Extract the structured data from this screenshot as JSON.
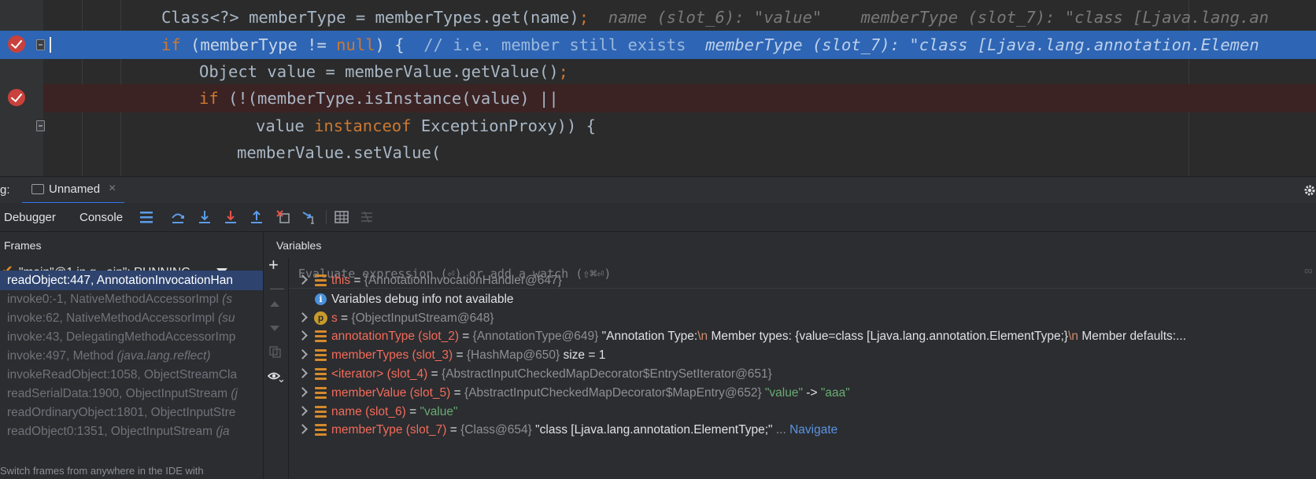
{
  "editor": {
    "lines": [
      {
        "code": [
          [
            "tx",
            "Class<?> memberType = memberTypes.get(name)"
          ],
          [
            "kw",
            ";"
          ]
        ],
        "inline": "  name (slot_6): \"value\"    memberType (slot_7): \"class [Ljava.lang.an"
      },
      {
        "code": [
          [
            "kw",
            "if "
          ],
          [
            "tx",
            "(memberType != "
          ],
          [
            "kw",
            "null"
          ],
          [
            "tx",
            ") {  "
          ],
          [
            "cm",
            "// i.e. member still exists"
          ]
        ],
        "inline": "  memberType (slot_7): \"class [Ljava.lang.annotation.Elemen"
      },
      {
        "code": [
          [
            "tx",
            "Object value = memberValue.getValue()"
          ],
          [
            "kw",
            ";"
          ]
        ],
        "inline": ""
      },
      {
        "code": [
          [
            "kw",
            "if "
          ],
          [
            "tx",
            "(!(memberType.isInstance(value) ||"
          ]
        ],
        "inline": ""
      },
      {
        "code": [
          [
            "tx",
            "value "
          ],
          [
            "kw",
            "instanceof "
          ],
          [
            "tx",
            "ExceptionProxy)) {"
          ]
        ],
        "inline": ""
      },
      {
        "code": [
          [
            "tx",
            "memberValue.setValue("
          ]
        ],
        "inline": ""
      }
    ]
  },
  "debug_bar": {
    "label": "g:",
    "session_tab": "Unnamed",
    "close_glyph": "×"
  },
  "tabs": {
    "debugger": "Debugger",
    "console": "Console"
  },
  "frames": {
    "header": "Frames",
    "thread": "\"main\"@1 in g...ain\": RUNNING",
    "items": [
      {
        "method": "readObject:447, AnnotationInvocationHan",
        "pkg": ""
      },
      {
        "method": "invoke0:-1, NativeMethodAccessorImpl ",
        "pkg": "(s"
      },
      {
        "method": "invoke:62, NativeMethodAccessorImpl ",
        "pkg": "(su"
      },
      {
        "method": "invoke:43, DelegatingMethodAccessorImp",
        "pkg": ""
      },
      {
        "method": "invoke:497, Method ",
        "pkg": "(java.lang.reflect)"
      },
      {
        "method": "invokeReadObject:1058, ObjectStreamCla",
        "pkg": ""
      },
      {
        "method": "readSerialData:1900, ObjectInputStream ",
        "pkg": "(j"
      },
      {
        "method": "readOrdinaryObject:1801, ObjectInputStre",
        "pkg": ""
      },
      {
        "method": "readObject0:1351, ObjectInputStream ",
        "pkg": "(ja"
      }
    ],
    "hint": "Switch frames from anywhere in the IDE with"
  },
  "variables": {
    "header": "Variables",
    "eval_placeholder": "Evaluate expression (⏎) or add a watch (⇧⌘⏎)",
    "rows": [
      {
        "icon": "field",
        "expand": true,
        "name": "this",
        "eq": " = ",
        "type": "{AnnotationInvocationHandler@647}",
        "rest": [],
        "nav": ""
      },
      {
        "icon": "info",
        "expand": false,
        "name": "",
        "eq": "",
        "type": "",
        "rest": [
          [
            "vw",
            "Variables debug info not available"
          ]
        ],
        "nav": ""
      },
      {
        "icon": "param",
        "expand": true,
        "name": "s",
        "eq": " = ",
        "type": "{ObjectInputStream@648}",
        "rest": [],
        "nav": ""
      },
      {
        "icon": "field",
        "expand": true,
        "name": "annotationType (slot_2)",
        "eq": " = ",
        "type": "{AnnotationType@649}",
        "rest": [
          [
            "vw",
            " \"Annotation Type:"
          ],
          [
            "vo",
            "\\n"
          ],
          [
            "vw",
            "   Member types: {value=class [Ljava.lang.annotation.ElementType;}"
          ],
          [
            "vo",
            "\\n"
          ],
          [
            "vw",
            "   Member defaults:..."
          ]
        ],
        "nav": ""
      },
      {
        "icon": "field",
        "expand": true,
        "name": "memberTypes (slot_3)",
        "eq": " = ",
        "type": "{HashMap@650}",
        "rest": [
          [
            "vw",
            "  size = 1"
          ]
        ],
        "nav": ""
      },
      {
        "icon": "field",
        "expand": true,
        "name": "<iterator> (slot_4)",
        "eq": " = ",
        "type": "{AbstractInputCheckedMapDecorator$EntrySetIterator@651}",
        "rest": [],
        "nav": ""
      },
      {
        "icon": "field",
        "expand": true,
        "name": "memberValue (slot_5)",
        "eq": " = ",
        "type": "{AbstractInputCheckedMapDecorator$MapEntry@652}",
        "rest": [
          [
            "vs",
            " \"value\""
          ],
          [
            "vw",
            " -> "
          ],
          [
            "vs",
            "\"aaa\""
          ]
        ],
        "nav": ""
      },
      {
        "icon": "field",
        "expand": true,
        "name": "name (slot_6)",
        "eq": " = ",
        "type": "",
        "rest": [
          [
            "vs",
            "\"value\""
          ]
        ],
        "nav": ""
      },
      {
        "icon": "field",
        "expand": true,
        "name": "memberType (slot_7)",
        "eq": " = ",
        "type": "{Class@654}",
        "rest": [
          [
            "vw",
            " \"class [Ljava.lang.annotation.ElementType;\""
          ],
          [
            "vt",
            " ... "
          ]
        ],
        "nav": "Navigate"
      }
    ]
  },
  "colors": {
    "execution_line": "#2e65b4",
    "breakpoint": "#c9413c",
    "selected_frame": "#2e436e"
  }
}
